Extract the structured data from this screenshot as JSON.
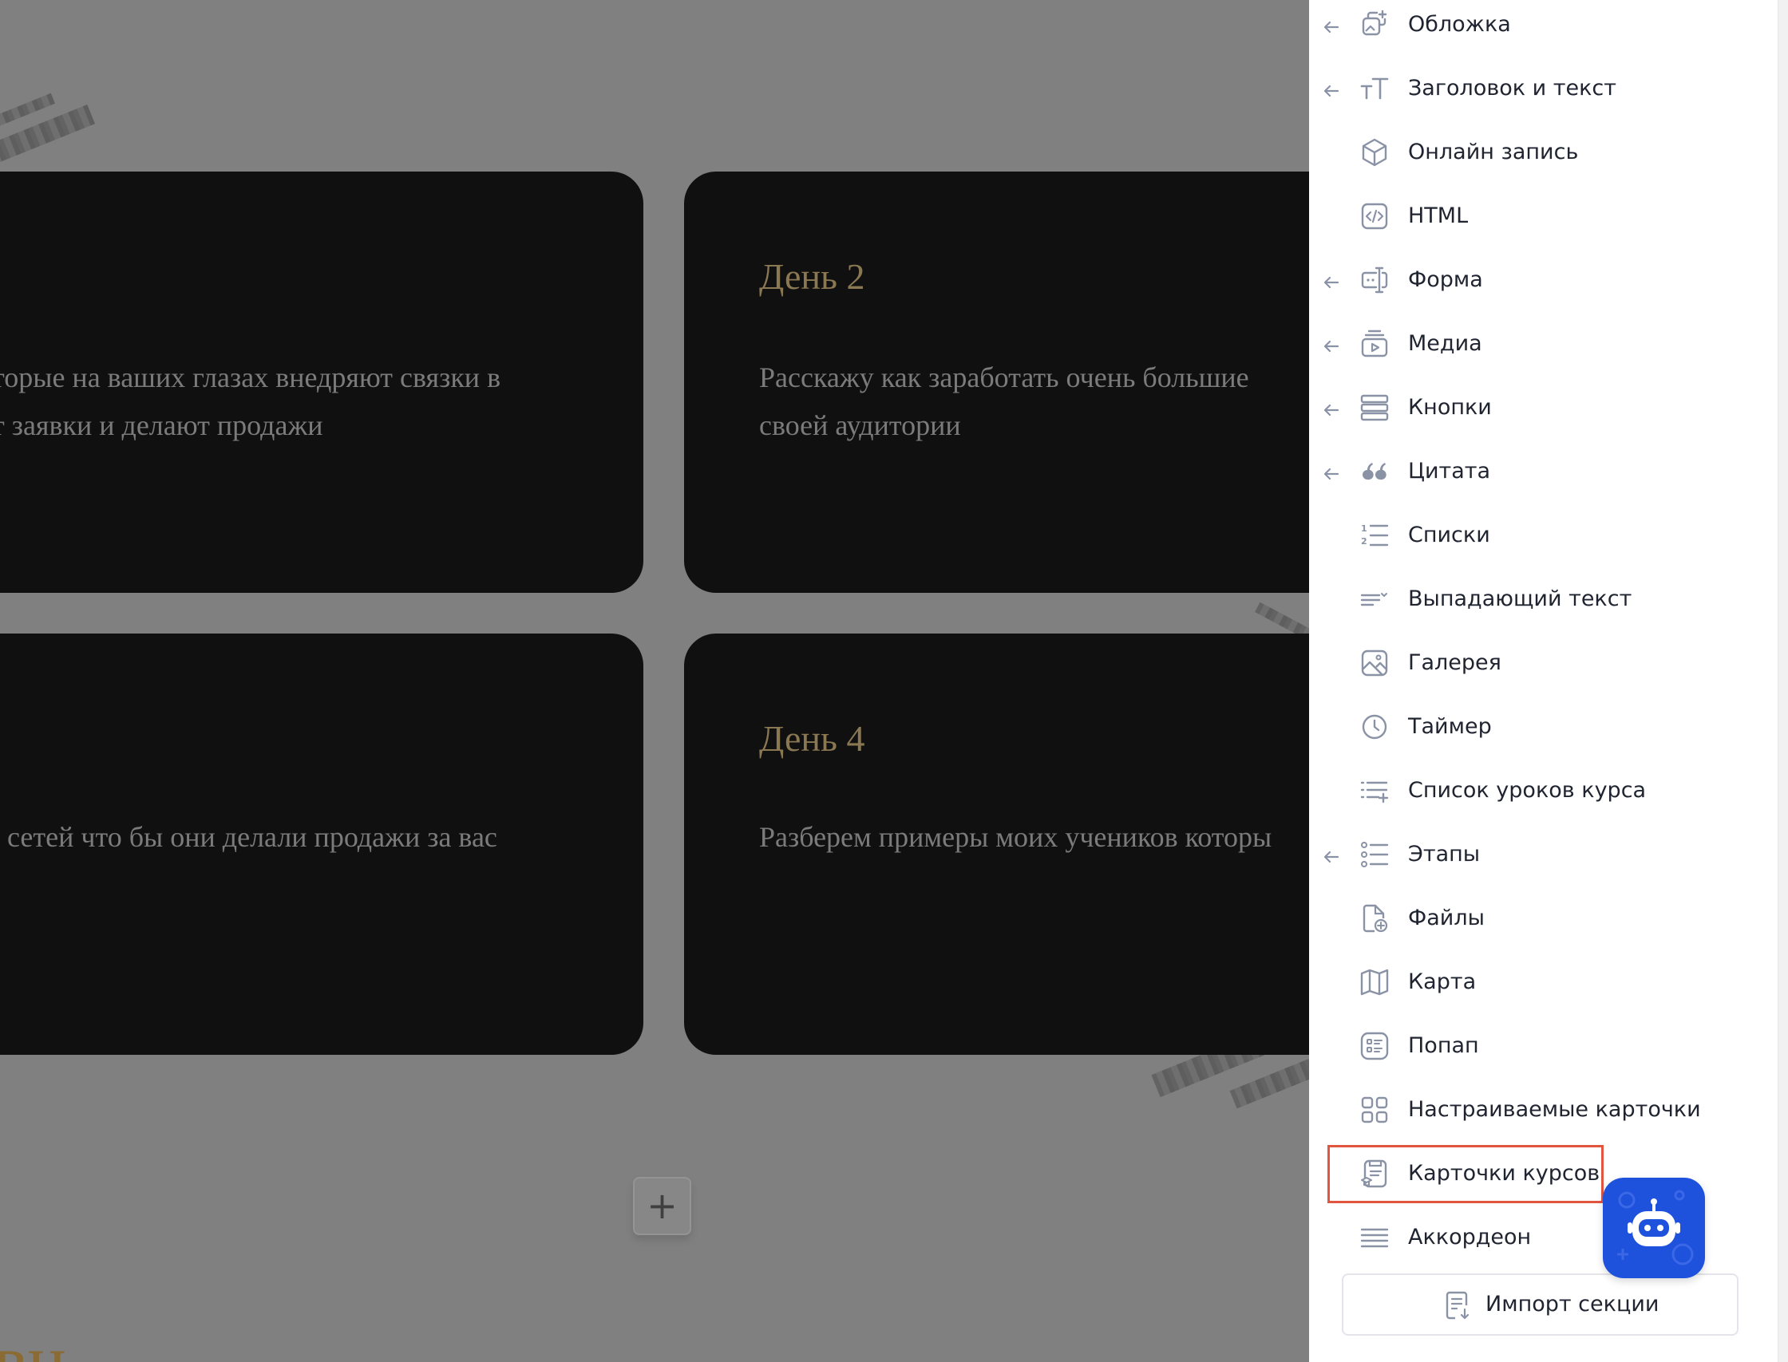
{
  "page": {
    "cards": [
      {
        "day": "",
        "text": "торые на ваших глазах внедряют связки в\nт заявки и делают продажи"
      },
      {
        "day": "День 2",
        "text": "Расскажу как заработать очень большие\nсвоей аудитории"
      },
      {
        "day": "",
        "text": " сетей что бы они делали продажи за вас"
      },
      {
        "day": "День 4",
        "text": "Разберем примеры моих учеников которы"
      }
    ],
    "add_button": "+",
    "bottom_heading_fragment": "вн"
  },
  "panel": {
    "blocks": [
      {
        "label": "Обложка",
        "icon": "cover-icon",
        "arrow": true
      },
      {
        "label": "Заголовок и текст",
        "icon": "text-size-icon",
        "arrow": true
      },
      {
        "label": "Онлайн запись",
        "icon": "box-icon",
        "arrow": false
      },
      {
        "label": "HTML",
        "icon": "code-icon",
        "arrow": false
      },
      {
        "label": "Форма",
        "icon": "form-icon",
        "arrow": true
      },
      {
        "label": "Медиа",
        "icon": "media-icon",
        "arrow": true
      },
      {
        "label": "Кнопки",
        "icon": "buttons-icon",
        "arrow": true
      },
      {
        "label": "Цитата",
        "icon": "quote-icon",
        "arrow": true
      },
      {
        "label": "Списки",
        "icon": "numbered-list-icon",
        "arrow": false
      },
      {
        "label": "Выпадающий текст",
        "icon": "dropdown-text-icon",
        "arrow": false
      },
      {
        "label": "Галерея",
        "icon": "gallery-icon",
        "arrow": false
      },
      {
        "label": "Таймер",
        "icon": "clock-icon",
        "arrow": false
      },
      {
        "label": "Список уроков курса",
        "icon": "lesson-list-icon",
        "arrow": false
      },
      {
        "label": "Этапы",
        "icon": "steps-icon",
        "arrow": true
      },
      {
        "label": "Файлы",
        "icon": "file-icon",
        "arrow": false
      },
      {
        "label": "Карта",
        "icon": "map-icon",
        "arrow": false
      },
      {
        "label": "Попап",
        "icon": "popup-icon",
        "arrow": false
      },
      {
        "label": "Настраиваемые карточки",
        "icon": "cards-grid-icon",
        "arrow": false
      },
      {
        "label": "Карточки курсов",
        "icon": "course-cards-icon",
        "arrow": false,
        "highlighted": true
      },
      {
        "label": "Аккордеон",
        "icon": "accordion-icon",
        "arrow": false
      }
    ],
    "import_button": "Импорт секции",
    "highlight_color": "#e2553f",
    "icon_color": "#8a93a6"
  },
  "assistant": {
    "icon": "robot-icon",
    "color": "#1f52dc"
  }
}
